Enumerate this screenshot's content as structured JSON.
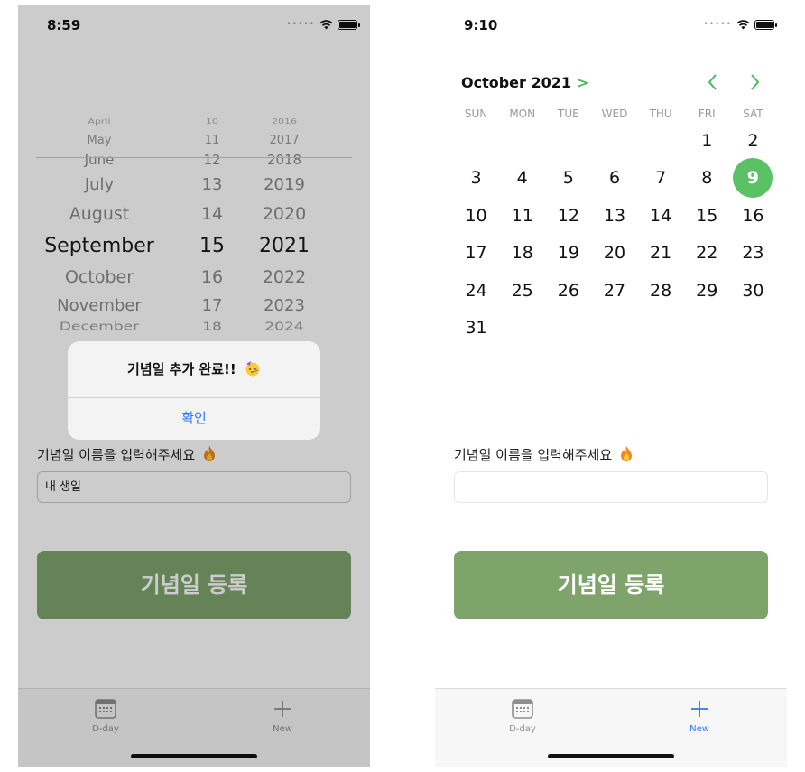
{
  "left": {
    "status_time": "8:59",
    "picker": {
      "rows": [
        {
          "month": "April",
          "day": "10",
          "year": "2016"
        },
        {
          "month": "May",
          "day": "11",
          "year": "2017"
        },
        {
          "month": "June",
          "day": "12",
          "year": "2018"
        },
        {
          "month": "July",
          "day": "13",
          "year": "2019"
        },
        {
          "month": "August",
          "day": "14",
          "year": "2020"
        },
        {
          "month": "September",
          "day": "15",
          "year": "2021"
        },
        {
          "month": "October",
          "day": "16",
          "year": "2022"
        },
        {
          "month": "November",
          "day": "17",
          "year": "2023"
        },
        {
          "month": "December",
          "day": "18",
          "year": "2024"
        }
      ]
    },
    "name_label": "기념일 이름을 입력해주세요",
    "name_value": "내 생일",
    "submit_label": "기념일 등록",
    "alert": {
      "title": "기념일 추가 완료!!",
      "confirm": "확인"
    },
    "tabs": [
      {
        "label": "D-day",
        "icon": "calendar-icon"
      },
      {
        "label": "New",
        "icon": "plus-icon"
      }
    ]
  },
  "right": {
    "status_time": "9:10",
    "month_title": "October 2021",
    "month_chevron": ">",
    "weekdays": [
      "SUN",
      "MON",
      "TUE",
      "WED",
      "THU",
      "FRI",
      "SAT"
    ],
    "days": [
      "",
      "",
      "",
      "",
      "",
      "1",
      "2",
      "3",
      "4",
      "5",
      "6",
      "7",
      "8",
      "9",
      "10",
      "11",
      "12",
      "13",
      "14",
      "15",
      "16",
      "17",
      "18",
      "19",
      "20",
      "21",
      "22",
      "23",
      "24",
      "25",
      "26",
      "27",
      "28",
      "29",
      "30",
      "31"
    ],
    "selected_day": "9",
    "name_label": "기념일 이름을 입력해주세요",
    "name_value": "",
    "submit_label": "기념일 등록",
    "tabs": [
      {
        "label": "D-day",
        "icon": "calendar-icon"
      },
      {
        "label": "New",
        "icon": "plus-icon"
      }
    ]
  },
  "colors": {
    "accent_green": "#5ac265",
    "button_green": "#7ea46c",
    "link_blue": "#2f7af0"
  }
}
